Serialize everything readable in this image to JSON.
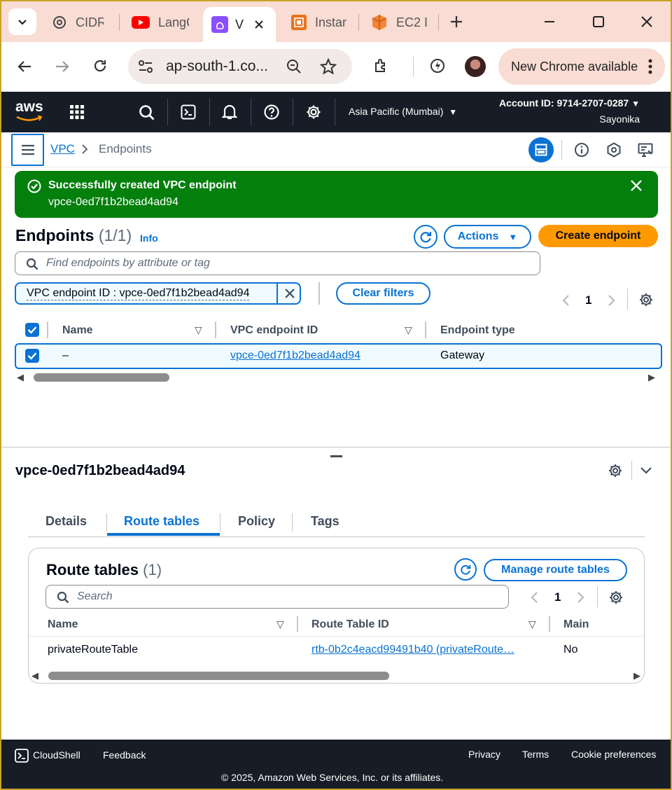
{
  "browser": {
    "tabs": [
      {
        "label": "CIDR",
        "icon": "chatgpt-icon"
      },
      {
        "label": "LangC",
        "icon": "youtube-icon"
      },
      {
        "label": "V",
        "icon": "vpc-icon"
      },
      {
        "label": "Instar",
        "icon": "aws-service-icon"
      },
      {
        "label": "EC2 I",
        "icon": "ec2-icon"
      }
    ],
    "url": "ap-south-1.co...",
    "new_chrome_label": "New Chrome available"
  },
  "aws_nav": {
    "logo": "aws",
    "region": "Asia Pacific (Mumbai)",
    "account_id": "Account ID: 9714-2707-0287",
    "user": "Sayonika"
  },
  "breadcrumb": {
    "parent": "VPC",
    "current": "Endpoints"
  },
  "flash": {
    "title": "Successfully created VPC endpoint",
    "message": "vpce-0ed7f1b2bead4ad94",
    "color": "#037f0c"
  },
  "endpoints": {
    "title": "Endpoints",
    "count": "(1/1)",
    "info": "Info",
    "actions_label": "Actions",
    "create_label": "Create endpoint",
    "search_placeholder": "Find endpoints by attribute or tag",
    "filter_token": "VPC endpoint ID : vpce-0ed7f1b2bead4ad94",
    "clear_filters": "Clear filters",
    "page": "1",
    "columns": [
      "Name",
      "VPC endpoint ID",
      "Endpoint type"
    ],
    "rows": [
      {
        "name": "–",
        "id": "vpce-0ed7f1b2bead4ad94",
        "type": "Gateway",
        "selected": true
      }
    ]
  },
  "detail": {
    "title": "vpce-0ed7f1b2bead4ad94",
    "tabs": [
      "Details",
      "Route tables",
      "Policy",
      "Tags"
    ],
    "active_tab": "Route tables",
    "route_tables": {
      "title": "Route tables",
      "count": "(1)",
      "manage_label": "Manage route tables",
      "search_placeholder": "Search",
      "page": "1",
      "columns": [
        "Name",
        "Route Table ID",
        "Main"
      ],
      "rows": [
        {
          "name": "privateRouteTable",
          "id": "rtb-0b2c4eacd99491b40 (privateRoute…",
          "main": "No"
        }
      ]
    }
  },
  "footer": {
    "cloudshell": "CloudShell",
    "feedback": "Feedback",
    "privacy": "Privacy",
    "terms": "Terms",
    "cookies": "Cookie preferences",
    "copyright": "© 2025, Amazon Web Services, Inc. or its affiliates."
  },
  "colors": {
    "accent": "#0972d3",
    "primary_button": "#ff9900",
    "nav_bg": "#161d26",
    "success": "#037f0c"
  }
}
